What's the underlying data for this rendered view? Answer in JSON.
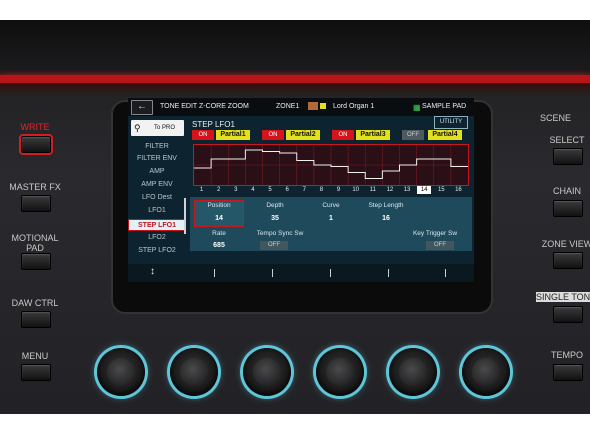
{
  "left_panel": {
    "write": "WRITE",
    "master_fx": "MASTER FX",
    "motional_pad": "MOTIONAL\nPAD",
    "daw_ctrl": "DAW CTRL",
    "menu": "MENU"
  },
  "right_panel": {
    "scene": "SCENE",
    "select": "SELECT",
    "chain": "CHAIN",
    "zone_view": "ZONE VIEW",
    "single_tone": "SINGLE TON",
    "tempo": "TEMPO"
  },
  "screen": {
    "header": {
      "back_icon": "back-arrow-icon",
      "mode": "TONE EDIT Z-CORE ZOOM",
      "zone": "ZONE1",
      "tone_name": "Lord Organ 1",
      "sample_pad": "SAMPLE PAD"
    },
    "to_pro": "To PRO",
    "menu_items": [
      "FILTER",
      "FILTER ENV",
      "AMP",
      "AMP ENV",
      "LFO Dest",
      "LFO1",
      "STEP LFO1",
      "LFO2",
      "STEP LFO2"
    ],
    "selected_menu": "STEP LFO1",
    "page_title": "STEP LFO1",
    "utility": "UTILITY",
    "partials": [
      {
        "on": "ON",
        "name": "Partial1",
        "enabled": true
      },
      {
        "on": "ON",
        "name": "Partial2",
        "enabled": true
      },
      {
        "on": "ON",
        "name": "Partial3",
        "enabled": true
      },
      {
        "on": "OFF",
        "name": "Partial4",
        "enabled": false
      }
    ],
    "step_values": [
      -2,
      4,
      4,
      10,
      9,
      8,
      3,
      0,
      -1,
      -5,
      -9,
      -4,
      0,
      4,
      4,
      -1
    ],
    "step_numbers": [
      "1",
      "2",
      "3",
      "4",
      "5",
      "6",
      "7",
      "8",
      "9",
      "10",
      "11",
      "12",
      "13",
      "14",
      "15",
      "16"
    ],
    "current_step": "14",
    "params": {
      "position_label": "Position",
      "position_value": "14",
      "depth_label": "Depth",
      "depth_value": "35",
      "curve_label": "Curve",
      "curve_value": "1",
      "step_length_label": "Step Length",
      "step_length_value": "16",
      "rate_label": "Rate",
      "rate_value": "685",
      "tempo_sync_label": "Tempo Sync Sw",
      "tempo_sync_value": "OFF",
      "key_trigger_label": "Key Trigger Sw",
      "key_trigger_value": "OFF"
    },
    "softbar_icon": "up-down-arrow-icon"
  },
  "colors": {
    "accent_red": "#c7181f",
    "partial_yellow": "#e3e11e",
    "knob_glow": "#5ec6d8"
  }
}
